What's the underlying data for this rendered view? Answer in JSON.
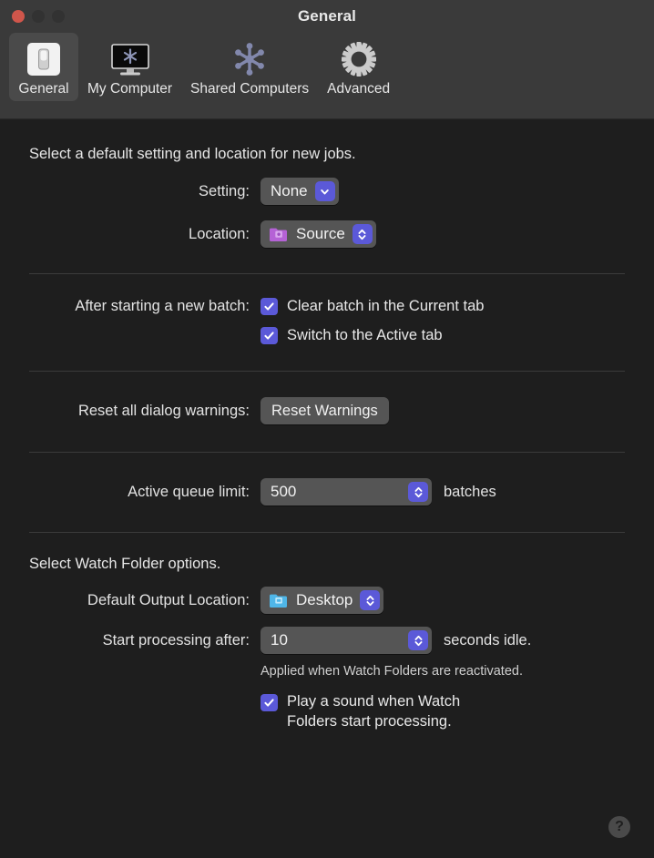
{
  "window": {
    "title": "General",
    "traffic_lights": [
      "close-button",
      "minimize-button",
      "maximize-button"
    ]
  },
  "toolbar": {
    "items": [
      {
        "label": "General",
        "icon": "light-switch-icon",
        "selected": true
      },
      {
        "label": "My Computer",
        "icon": "display-icon",
        "selected": false
      },
      {
        "label": "Shared Computers",
        "icon": "network-node-icon",
        "selected": false
      },
      {
        "label": "Advanced",
        "icon": "gear-icon",
        "selected": false
      }
    ]
  },
  "sections": {
    "defaults": {
      "heading": "Select a default setting and location for new jobs.",
      "setting_label": "Setting:",
      "setting_value": "None",
      "location_label": "Location:",
      "location_value": "Source",
      "location_icon": "purple-settings-folder-icon"
    },
    "batch": {
      "label": "After starting a new batch:",
      "checkboxes": [
        {
          "label": "Clear batch in the Current tab",
          "checked": true
        },
        {
          "label": "Switch to the Active tab",
          "checked": true
        }
      ]
    },
    "warnings": {
      "label": "Reset all dialog warnings:",
      "button_label": "Reset Warnings"
    },
    "queue": {
      "label": "Active queue limit:",
      "value": "500",
      "unit": "batches"
    },
    "watch": {
      "heading": "Select Watch Folder options.",
      "output_label": "Default Output Location:",
      "output_value": "Desktop",
      "output_icon": "blue-folder-icon",
      "delay_label": "Start processing after:",
      "delay_value": "10",
      "delay_unit": "seconds idle.",
      "hint": "Applied when Watch Folders are reactivated.",
      "sound_checkbox": {
        "line1": "Play a sound when Watch",
        "line2": "Folders start processing.",
        "checked": true
      }
    }
  },
  "help": {
    "label": "?"
  },
  "colors": {
    "accent": "#5b59d8",
    "toolbar_bg": "#3a3a3a",
    "content_bg": "#1e1e1e",
    "control_bg": "#555555",
    "close_light": "#d0564b",
    "separator": "#3b3b3b"
  }
}
